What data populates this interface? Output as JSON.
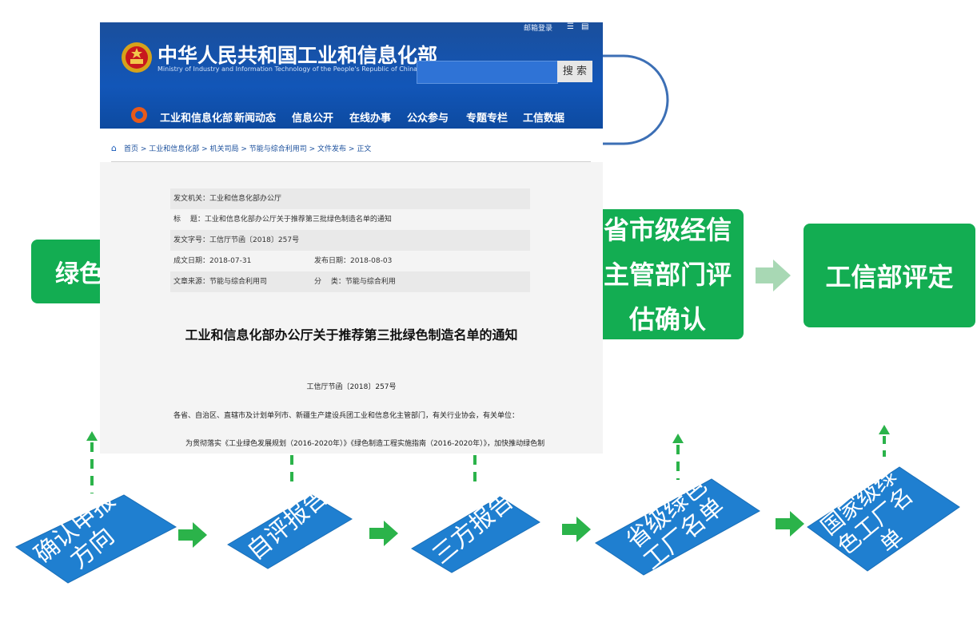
{
  "website": {
    "title": "中华人民共和国工业和信息化部",
    "subtitle": "Ministry of Industry and Information Technology of the People's Republic of China",
    "top_links": [
      "邮箱登录"
    ],
    "search_button": "搜 索",
    "nav_items": [
      "工业和信息化部",
      "新闻动态",
      "信息公开",
      "在线办事",
      "公众参与",
      "专题专栏",
      "工信数据"
    ],
    "breadcrumb": "首页 > 工业和信息化部 > 机关司局 > 节能与综合利用司 > 文件发布 > 正文",
    "meta": {
      "issuer": "发文机关：工业和信息化部办公厅",
      "title_line": "标　 题：工业和信息化部办公厅关于推荐第三批绿色制造名单的通知",
      "doc_no": "发文字号：工信厅节函〔2018〕257号",
      "written_date": "成文日期：2018-07-31",
      "publish_date": "发布日期：2018-08-03",
      "source": "文章来源：节能与综合利用司",
      "category": "分　 类：节能与综合利用"
    },
    "doc_title": "工业和信息化部办公厅关于推荐第三批绿色制造名单的通知",
    "doc_number": "工信厅节函〔2018〕257号",
    "salutation": "各省、自治区、直辖市及计划单列市、新疆生产建设兵团工业和信息化主管部门，有关行业协会，有关单位：",
    "body_start": "为贯彻落实《工业绿色发展规划（2016-2020年）》《绿色制造工程实施指南（2016-2020年）》，加快推动绿色制"
  },
  "flow_top": {
    "box_left": "绿色",
    "box_provincial": "省市级经信\n主管部门评\n估确认",
    "box_ministry": "工信部评定"
  },
  "flow_bottom": {
    "steps": [
      "确认申报\n方向",
      "自评报告",
      "三方报告",
      "省级绿色\n工厂名单",
      "国家级绿\n色工厂名\n单"
    ]
  },
  "colors": {
    "green": "#13ad52",
    "blue_diamond": "#1f7fd0",
    "arrow_green": "#2bb34a",
    "light_arrow": "#a8d8b4",
    "connector": "#3c6fb5"
  }
}
